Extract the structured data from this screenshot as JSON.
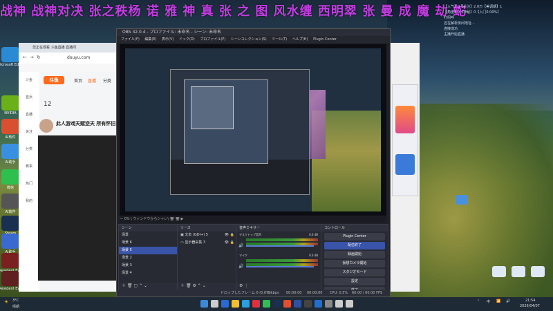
{
  "banner": {
    "text": "战神 战神对决 张之秩杨 诺 雅 神 真 张 之 图 风水缠 西明翠 张 曼 成 魔 劫 蛇"
  },
  "overlay": {
    "lines": [
      "【入气】0【关注】2.0万【美调期】1",
      "【角度】0【神秘】0【入门0.00%】",
      "打招呼",
      "还在解析房间地址...",
      "连接成功",
      "主播开始直播"
    ]
  },
  "desktop_icons": [
    {
      "label": "Microsoft Edge",
      "color": "#2a8ad4"
    },
    {
      "label": "NVIDIA",
      "color": "#6ab018"
    },
    {
      "label": "AI软件",
      "color": "#d85030"
    },
    {
      "label": "AI助手",
      "color": "#3a90e0"
    },
    {
      "label": "微信",
      "color": "#2fbf4f"
    },
    {
      "label": "AI软件",
      "color": "#555"
    },
    {
      "label": "Steam",
      "color": "#1a3050"
    },
    {
      "label": "AI助手",
      "color": "#3a6ad0"
    },
    {
      "label": "Resident Evil",
      "color": "#7a2020"
    },
    {
      "label": "Resident Evil",
      "color": "#602020"
    }
  ],
  "browser": {
    "tab_title": "您正在观看 斗鱼直播 直播间",
    "address": "douyu.com",
    "site_name": "斗鱼",
    "nav": [
      "首页",
      "直播",
      "分类"
    ],
    "count": "12",
    "room_title": "此人游戏天赋逆天 所有怀旧",
    "sidebar": [
      "斗鱼",
      "首页",
      "直播",
      "关注",
      "分类",
      "赛事",
      "热门",
      "我的"
    ]
  },
  "obs": {
    "title": "OBS 32.0.4 - プロファイル: 未命名 - シーン: 未命名",
    "menu": [
      "ファイル(F)",
      "編集(E)",
      "表示(V)",
      "ドック(D)",
      "プロファイル(P)",
      "シーンコレクション(S)",
      "ツール(T)",
      "ヘルプ(H)",
      "Plugin Center"
    ],
    "status_line": "— 0% \\ ウィンドウからシャレ\\ 🖥 🖥 ▶",
    "scenes_title": "シーン",
    "scenes": [
      "场景",
      "场景 6",
      "场景 5",
      "场景 2",
      "场景 3",
      "场景 4"
    ],
    "selected_scene": 2,
    "sources_title": "ソース",
    "sources": [
      "文本 (GDI+) 5",
      "显示器采集 3"
    ],
    "mixer_title": "音声ミキサー",
    "mixer": [
      {
        "name": "デスクトップ音声",
        "db": "0.0 dB"
      },
      {
        "name": "マイク",
        "db": "0.0 dB"
      }
    ],
    "controls_title": "コントロール",
    "controls": [
      "Plugin Center",
      "配信終了",
      "録画開始",
      "仮想カメラ開始",
      "スタジオモード",
      "設定",
      "終了"
    ],
    "footer": {
      "frames": "ドロップしたフレーム 0 (0.0%)",
      "bitrate": "0 kbps",
      "rec": "00:00:00",
      "live": "00:00:00",
      "cpu": "CPU: 0.5%",
      "fps": "60.00 / 60.00 FPS"
    }
  },
  "taskbar": {
    "weather_temp": "3°C",
    "weather_desc": "晴朗",
    "ime": "中",
    "time": "21:54",
    "date": "2026/04/07"
  },
  "colors": {
    "accent": "#3954a8",
    "banner": "#e040ff"
  }
}
